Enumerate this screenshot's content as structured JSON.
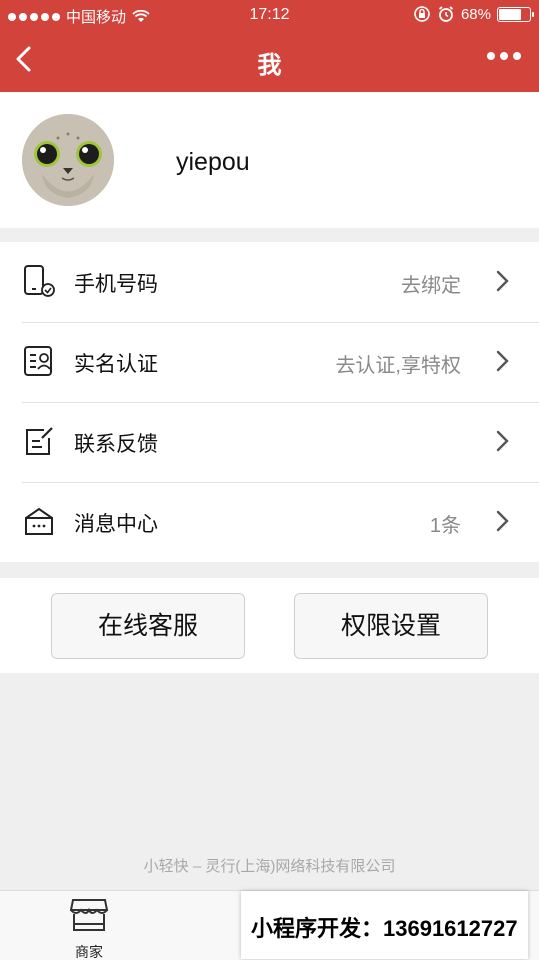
{
  "status_bar": {
    "carrier": "中国移动",
    "time": "17:12",
    "battery": "68%",
    "battery_level": 0.68
  },
  "nav": {
    "title": "我"
  },
  "profile": {
    "username": "yiepou"
  },
  "menu": {
    "items": [
      {
        "label": "手机号码",
        "value": "去绑定",
        "icon": "phone-check-icon"
      },
      {
        "label": "实名认证",
        "value": "去认证,享特权",
        "icon": "id-card-icon"
      },
      {
        "label": "联系反馈",
        "value": "",
        "icon": "edit-note-icon"
      },
      {
        "label": "消息中心",
        "value": "1条",
        "icon": "message-box-icon"
      }
    ]
  },
  "buttons": {
    "online_service": "在线客服",
    "permission_settings": "权限设置"
  },
  "footer": {
    "copyright": "小轻快 – 灵行(上海)网络科技有限公司"
  },
  "tabbar": {
    "shop_label": "商家"
  },
  "ad": {
    "text": "小程序开发：13691612727"
  },
  "colors": {
    "header_red": "#d2443b",
    "gray_text": "#8a8a8a",
    "background": "#efefef"
  }
}
